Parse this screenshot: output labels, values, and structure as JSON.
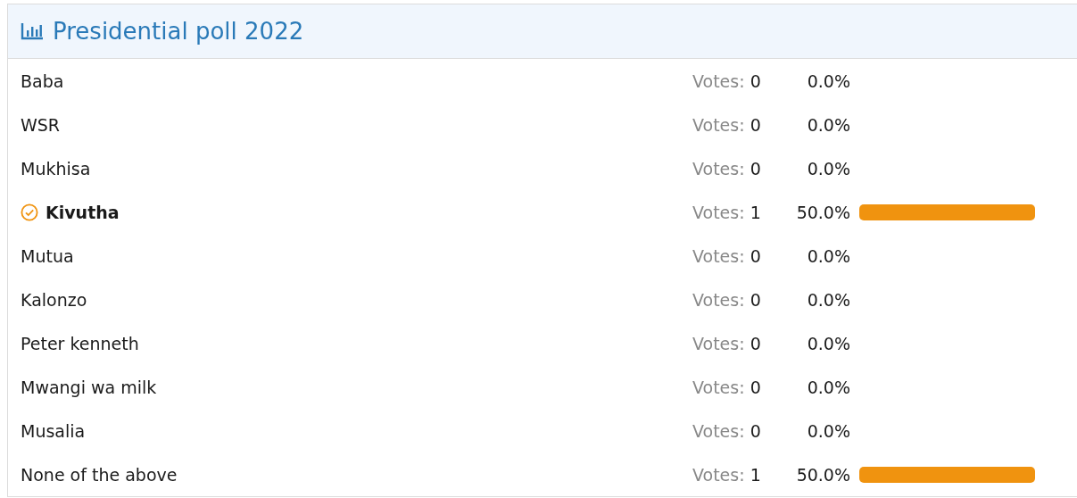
{
  "poll": {
    "title": "Presidential poll 2022",
    "options": [
      {
        "name": "Baba",
        "voted": false,
        "votes_label": "Votes:",
        "votes": "0",
        "percent": "0.0%",
        "bar": false
      },
      {
        "name": "WSR",
        "voted": false,
        "votes_label": "Votes:",
        "votes": "0",
        "percent": "0.0%",
        "bar": false
      },
      {
        "name": "Mukhisa",
        "voted": false,
        "votes_label": "Votes:",
        "votes": "0",
        "percent": "0.0%",
        "bar": false
      },
      {
        "name": "Kivutha",
        "voted": true,
        "votes_label": "Votes:",
        "votes": "1",
        "percent": "50.0%",
        "bar": true
      },
      {
        "name": "Mutua",
        "voted": false,
        "votes_label": "Votes:",
        "votes": "0",
        "percent": "0.0%",
        "bar": false
      },
      {
        "name": "Kalonzo",
        "voted": false,
        "votes_label": "Votes:",
        "votes": "0",
        "percent": "0.0%",
        "bar": false
      },
      {
        "name": "Peter kenneth",
        "voted": false,
        "votes_label": "Votes:",
        "votes": "0",
        "percent": "0.0%",
        "bar": false
      },
      {
        "name": "Mwangi wa milk",
        "voted": false,
        "votes_label": "Votes:",
        "votes": "0",
        "percent": "0.0%",
        "bar": false
      },
      {
        "name": "Musalia",
        "voted": false,
        "votes_label": "Votes:",
        "votes": "0",
        "percent": "0.0%",
        "bar": false
      },
      {
        "name": "None of the above",
        "voted": false,
        "votes_label": "Votes:",
        "votes": "1",
        "percent": "50.0%",
        "bar": true
      }
    ]
  }
}
